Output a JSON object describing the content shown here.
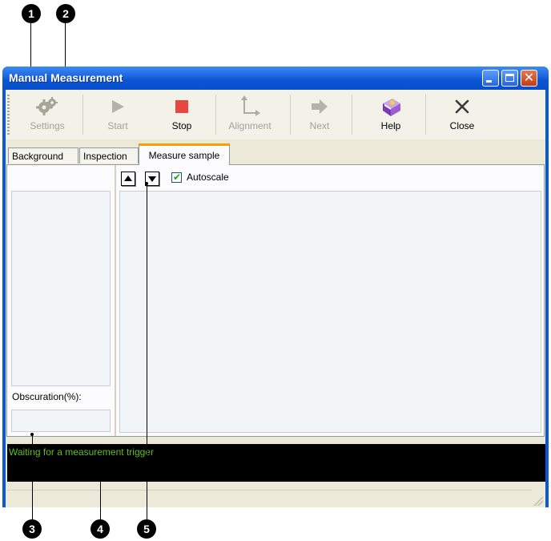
{
  "callouts": [
    "1",
    "2",
    "3",
    "4",
    "5"
  ],
  "window": {
    "title": "Manual Measurement",
    "caption_buttons": {
      "minimize": "_",
      "maximize": "□",
      "close": "✕"
    }
  },
  "toolbar": {
    "items": [
      {
        "label": "Settings",
        "icon": "gear-icon",
        "enabled": false
      },
      {
        "label": "Start",
        "icon": "play-icon",
        "enabled": false
      },
      {
        "label": "Stop",
        "icon": "stop-icon",
        "enabled": true
      },
      {
        "label": "Alignment",
        "icon": "alignment-icon",
        "enabled": false
      },
      {
        "label": "Next",
        "icon": "arrow-right-icon",
        "enabled": false
      },
      {
        "label": "Help",
        "icon": "help-book-icon",
        "enabled": true
      },
      {
        "label": "Close",
        "icon": "close-x-icon",
        "enabled": true
      }
    ]
  },
  "tabs": [
    {
      "label": "Background",
      "active": false
    },
    {
      "label": "Inspection",
      "active": false
    },
    {
      "label": "Measure sample",
      "active": true
    }
  ],
  "measure": {
    "obscuration_label": "Obscuration(%):",
    "obscuration_value": "",
    "autoscale_label": "Autoscale",
    "autoscale_checked": true
  },
  "status": {
    "message": "Waiting for a measurement trigger"
  },
  "colors": {
    "stop_red": "#e8473f",
    "status_text_green": "#5fbf1f",
    "active_tab_accent": "#ff9c00",
    "titlebar_blue": "#0a57d8"
  }
}
